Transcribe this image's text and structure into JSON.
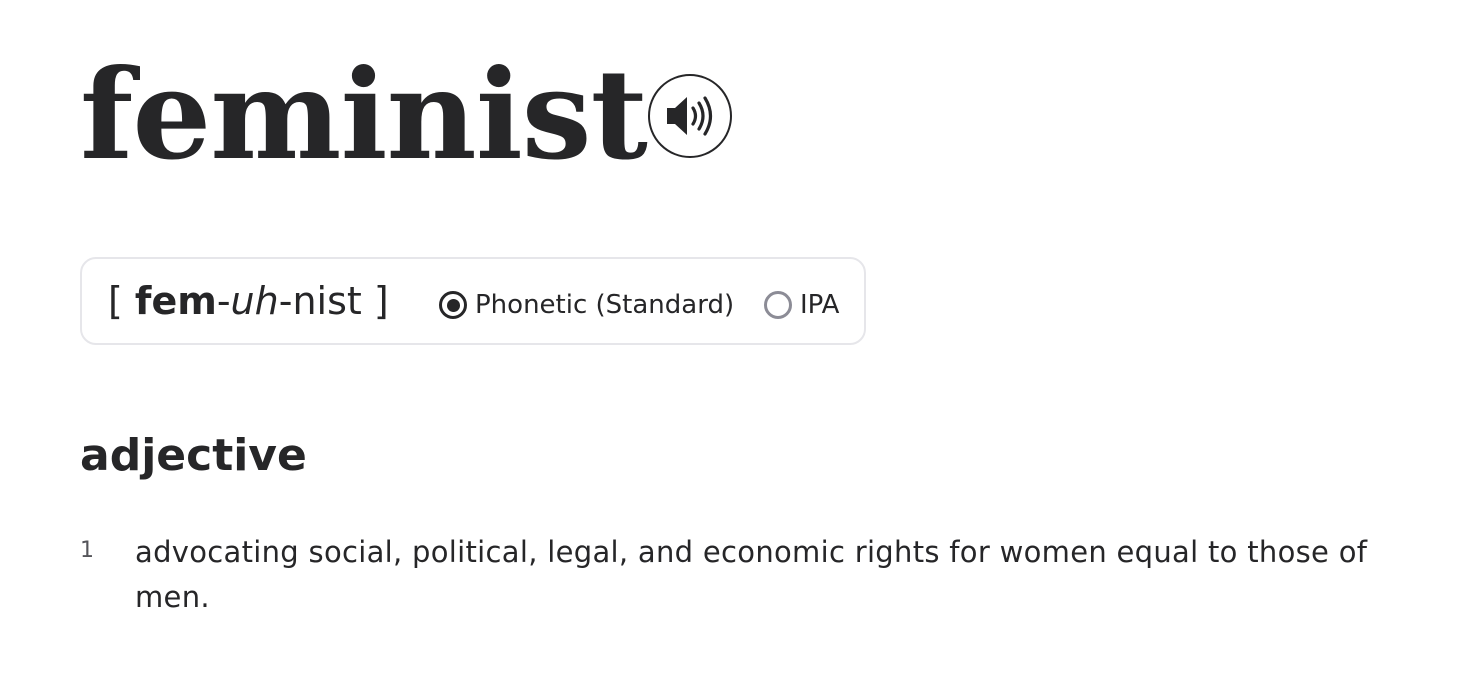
{
  "entry": {
    "headword": "feminist",
    "audio_icon": "speaker-icon"
  },
  "pronunciation": {
    "open_bracket": "[",
    "syllable_stressed": "fem",
    "hyphen_1": "-",
    "syllable_unstressed": "uh",
    "hyphen_2": "-",
    "syllable_end": "nist",
    "close_bracket": "]",
    "options": [
      {
        "label": "Phonetic (Standard)",
        "selected": true
      },
      {
        "label": "IPA",
        "selected": false
      }
    ]
  },
  "part_of_speech": "adjective",
  "definitions": [
    {
      "number": "1",
      "text": "advocating social, political, legal, and economic rights for women equal to those of men."
    }
  ],
  "colors": {
    "text": "#262628",
    "border": "#e6e6ea",
    "radio_unchecked": "#8c8c96"
  }
}
